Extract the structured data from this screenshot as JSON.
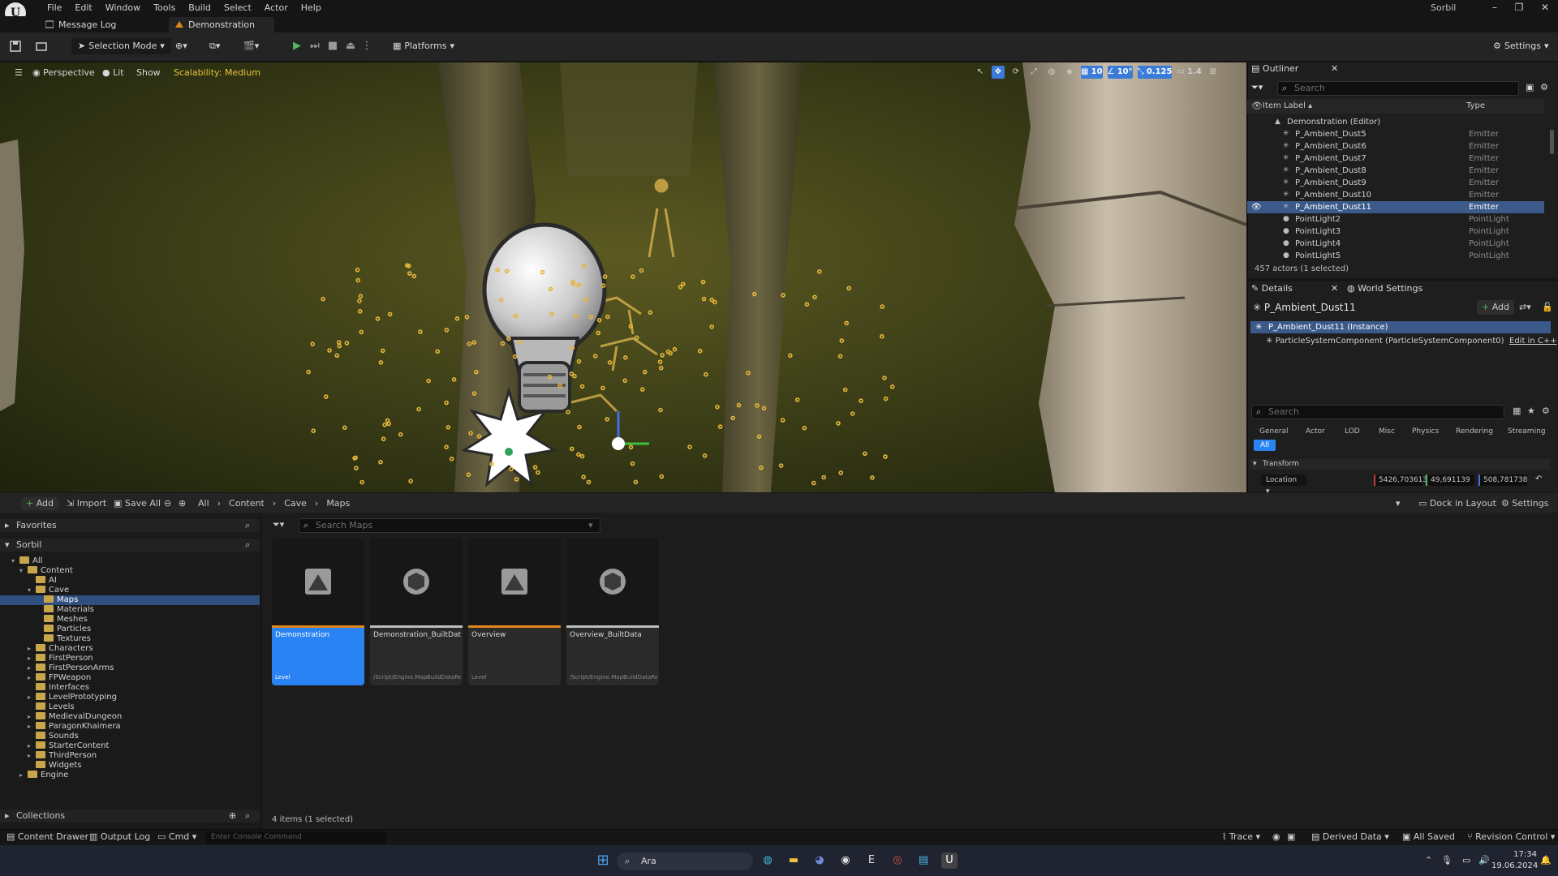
{
  "menubar": {
    "items": [
      "File",
      "Edit",
      "Window",
      "Tools",
      "Build",
      "Select",
      "Actor",
      "Help"
    ],
    "project": "Sorbil"
  },
  "tabs": [
    "Message Log",
    "Demonstration"
  ],
  "toolbar": {
    "selection_mode": "Selection Mode",
    "platforms": "Platforms",
    "settings": "Settings"
  },
  "viewport": {
    "perspective": "Perspective",
    "lit": "Lit",
    "show": "Show",
    "scalability": "Scalability: Medium",
    "grid": "10",
    "angle": "10°",
    "scale": "0.125",
    "camera": "1.4"
  },
  "outliner": {
    "title": "Outliner",
    "search_placeholder": "Search",
    "col_label": "Item Label",
    "col_type": "Type",
    "root": "Demonstration (Editor)",
    "rows": [
      {
        "label": "P_Ambient_Dust5",
        "type": "Emitter"
      },
      {
        "label": "P_Ambient_Dust6",
        "type": "Emitter"
      },
      {
        "label": "P_Ambient_Dust7",
        "type": "Emitter"
      },
      {
        "label": "P_Ambient_Dust8",
        "type": "Emitter"
      },
      {
        "label": "P_Ambient_Dust9",
        "type": "Emitter"
      },
      {
        "label": "P_Ambient_Dust10",
        "type": "Emitter"
      },
      {
        "label": "P_Ambient_Dust11",
        "type": "Emitter"
      },
      {
        "label": "PointLight2",
        "type": "PointLight"
      },
      {
        "label": "PointLight3",
        "type": "PointLight"
      },
      {
        "label": "PointLight4",
        "type": "PointLight"
      },
      {
        "label": "PointLight5",
        "type": "PointLight"
      }
    ],
    "selected_index": 6,
    "count": "457 actors (1 selected)"
  },
  "details": {
    "tab": "Details",
    "tab2": "World Settings",
    "actor": "P_Ambient_Dust11",
    "add": "Add",
    "instance": "P_Ambient_Dust11 (Instance)",
    "component": "ParticleSystemComponent (ParticleSystemComponent0)",
    "edit_cpp": "Edit in C++",
    "search_placeholder": "Search",
    "categories": [
      "General",
      "Actor",
      "LOD",
      "Misc",
      "Physics",
      "Rendering",
      "Streaming"
    ],
    "all": "All",
    "transform": "Transform",
    "location_label": "Location",
    "location": [
      "5426,703613",
      "49,691139",
      "508,781738"
    ]
  },
  "content_browser": {
    "add": "Add",
    "import": "Import",
    "save_all": "Save All",
    "path": [
      "All",
      "Content",
      "Cave",
      "Maps"
    ],
    "dock": "Dock in Layout",
    "settings": "Settings",
    "search_placeholder": "Search Maps",
    "favorites": "Favorites",
    "project": "Sorbil",
    "tree": [
      {
        "label": "All",
        "indent": 0,
        "tw": "▾"
      },
      {
        "label": "Content",
        "indent": 1,
        "tw": "▾"
      },
      {
        "label": "AI",
        "indent": 2,
        "tw": ""
      },
      {
        "label": "Cave",
        "indent": 2,
        "tw": "▾"
      },
      {
        "label": "Maps",
        "indent": 3,
        "tw": "",
        "sel": true
      },
      {
        "label": "Materials",
        "indent": 3,
        "tw": ""
      },
      {
        "label": "Meshes",
        "indent": 3,
        "tw": ""
      },
      {
        "label": "Particles",
        "indent": 3,
        "tw": ""
      },
      {
        "label": "Textures",
        "indent": 3,
        "tw": ""
      },
      {
        "label": "Characters",
        "indent": 2,
        "tw": "▸"
      },
      {
        "label": "FirstPerson",
        "indent": 2,
        "tw": "▸"
      },
      {
        "label": "FirstPersonArms",
        "indent": 2,
        "tw": "▸"
      },
      {
        "label": "FPWeapon",
        "indent": 2,
        "tw": "▸"
      },
      {
        "label": "Interfaces",
        "indent": 2,
        "tw": ""
      },
      {
        "label": "LevelPrototyping",
        "indent": 2,
        "tw": "▸"
      },
      {
        "label": "Levels",
        "indent": 2,
        "tw": ""
      },
      {
        "label": "MedievalDungeon",
        "indent": 2,
        "tw": "▸"
      },
      {
        "label": "ParagonKhaimera",
        "indent": 2,
        "tw": "▸"
      },
      {
        "label": "Sounds",
        "indent": 2,
        "tw": ""
      },
      {
        "label": "StarterContent",
        "indent": 2,
        "tw": "▸"
      },
      {
        "label": "ThirdPerson",
        "indent": 2,
        "tw": "▸"
      },
      {
        "label": "Widgets",
        "indent": 2,
        "tw": ""
      },
      {
        "label": "Engine",
        "indent": 1,
        "tw": "▸"
      }
    ],
    "assets": [
      {
        "name": "Demonstration",
        "sub": "Level",
        "icon": "level",
        "color": "#e0861c"
      },
      {
        "name": "Demonstration_BuiltData",
        "sub": "/Script/Engine.MapBuildDataRe...",
        "icon": "data",
        "color": "#bdbdbd"
      },
      {
        "name": "Overview",
        "sub": "Level",
        "icon": "level",
        "color": "#e0861c"
      },
      {
        "name": "Overview_BuiltData",
        "sub": "/Script/Engine.MapBuildDataRe...",
        "icon": "data",
        "color": "#bdbdbd"
      }
    ],
    "selected_asset": 0,
    "collections": "Collections",
    "status": "4 items (1 selected)"
  },
  "statusbar": {
    "content_drawer": "Content Drawer",
    "output_log": "Output Log",
    "cmd": "Cmd",
    "console_placeholder": "Enter Console Command",
    "trace": "Trace",
    "derived": "Derived Data",
    "saved": "All Saved",
    "revision": "Revision Control"
  },
  "taskbar": {
    "search": "Ara",
    "time": "17:34",
    "date": "19.06.2024"
  }
}
